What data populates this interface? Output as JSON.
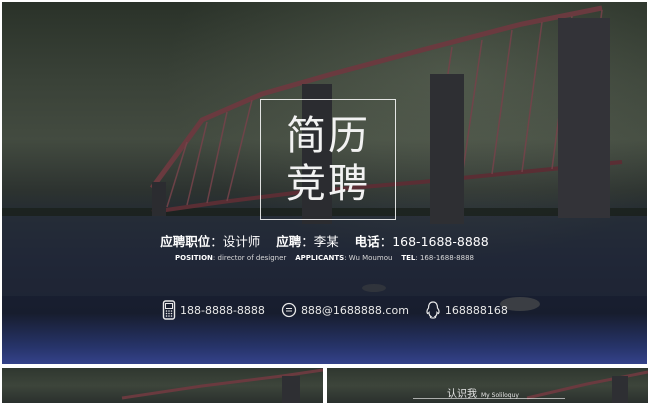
{
  "title": {
    "line1": "简历",
    "line2": "竞聘"
  },
  "info_cn": {
    "position_label": "应聘职位",
    "position_value": "设计师",
    "applicant_label": "应聘",
    "applicant_value": "李某",
    "phone_label": "电话",
    "phone_value": "168-1688-8888"
  },
  "info_en": {
    "position_label": "POSITION",
    "position_value": "director of designer",
    "applicants_label": "APPLICANTS",
    "applicants_value": "Wu Moumou",
    "tel_label": "TEL",
    "tel_value": "168-1688-8888"
  },
  "contacts": {
    "mobile": "188-8888-8888",
    "email": "888@1688888.com",
    "qq": "168888168"
  },
  "thumbnail_right": {
    "title_cn": "认识我",
    "title_en": "My Soliloquy"
  }
}
